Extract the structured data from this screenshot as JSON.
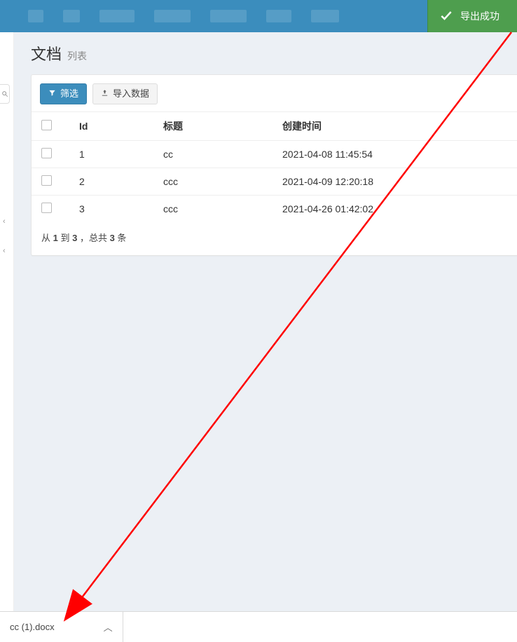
{
  "toast": {
    "text": "导出成功"
  },
  "header": {
    "title": "文档",
    "subtitle": "列表"
  },
  "toolbar": {
    "filter_label": "筛选",
    "import_label": "导入数据"
  },
  "table": {
    "columns": {
      "id": "Id",
      "title": "标题",
      "created_at": "创建时间"
    },
    "rows": [
      {
        "id": "1",
        "title": "cc",
        "created_at": "2021-04-08 11:45:54"
      },
      {
        "id": "2",
        "title": "ccc",
        "created_at": "2021-04-09 12:20:18"
      },
      {
        "id": "3",
        "title": "ccc",
        "created_at": "2021-04-26 01:42:02"
      }
    ]
  },
  "pager": {
    "prefix": "从 ",
    "from": "1",
    "mid": " 到 ",
    "to": "3",
    "sep": " ，总共 ",
    "total": "3",
    "suffix": " 条"
  },
  "download": {
    "filename": "cc (1).docx"
  }
}
